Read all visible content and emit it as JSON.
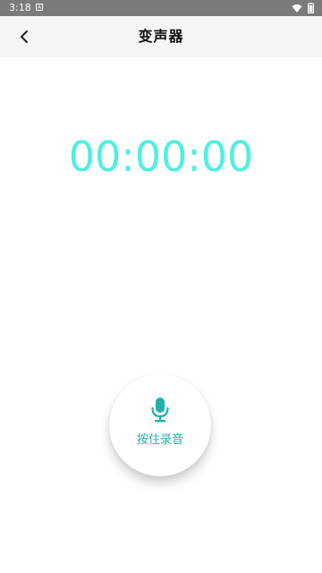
{
  "status_bar": {
    "time": "3:18",
    "notification_badge": "A",
    "icons": [
      "wifi-icon",
      "battery-icon"
    ]
  },
  "header": {
    "title": "变声器",
    "back_icon": "chevron-left-icon"
  },
  "timer": {
    "value": "00:00:00",
    "color": "#4ef0e0"
  },
  "record_button": {
    "label": "按住录音",
    "icon": "microphone-icon",
    "accent_color": "#1fb2a8"
  }
}
